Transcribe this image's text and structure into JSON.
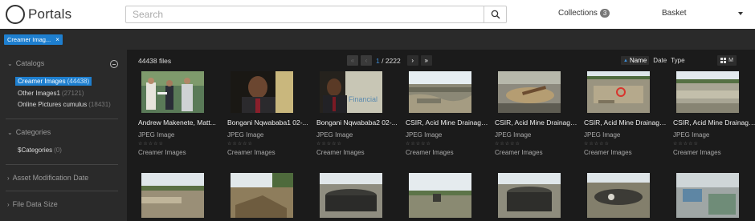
{
  "header": {
    "logo_text": "Portals",
    "search_placeholder": "Search",
    "collections_label": "Collections",
    "collections_count": "3",
    "basket_label": "Basket"
  },
  "filter": {
    "tag_label": "Creamer Imag...",
    "close_glyph": "×"
  },
  "sidebar": {
    "catalogs_title": "Catalogs",
    "catalogs": [
      {
        "name": "Creamer Images",
        "count": "(44438)",
        "selected": true
      },
      {
        "name": "Other Images1",
        "count": "(27121)",
        "selected": false
      },
      {
        "name": "Online Pictures cumulus",
        "count": "(18431)",
        "selected": false
      }
    ],
    "categories_title": "Categories",
    "categories": [
      {
        "name": "$Categories",
        "count": "(0)"
      }
    ],
    "asset_mod_title": "Asset Modification Date",
    "file_size_title": "File Data Size"
  },
  "toolbar": {
    "file_count": "44438 files",
    "current_page": "1",
    "total_pages": "/ 2222",
    "sort_name": "Name",
    "sort_date": "Date",
    "sort_type": "Type",
    "view_label": "M"
  },
  "assets_row1": [
    {
      "title": "Andrew Makenete, Matt...",
      "type": "JPEG Image",
      "catalog": "Creamer Images",
      "stars": "☆☆☆☆☆"
    },
    {
      "title": "Bongani Nqwababa1 02-...",
      "type": "JPEG Image",
      "catalog": "Creamer Images",
      "stars": "☆☆☆☆☆"
    },
    {
      "title": "Bongani Nqwababa2 02-...",
      "type": "JPEG Image",
      "catalog": "Creamer Images",
      "stars": "☆☆☆☆☆"
    },
    {
      "title": "CSIR, Acid Mine Drainage...",
      "type": "JPEG Image",
      "catalog": "Creamer Images",
      "stars": "☆☆☆☆☆"
    },
    {
      "title": "CSIR, Acid Mine Drainage...",
      "type": "JPEG Image",
      "catalog": "Creamer Images",
      "stars": "☆☆☆☆☆"
    },
    {
      "title": "CSIR, Acid Mine Drainage...",
      "type": "JPEG Image",
      "catalog": "Creamer Images",
      "stars": "☆☆☆☆☆"
    },
    {
      "title": "CSIR, Acid Mine Drainage...",
      "type": "JPEG Image",
      "catalog": "Creamer Images",
      "stars": "☆☆☆☆☆"
    }
  ],
  "thumb_text": {
    "financial": "Financial"
  }
}
